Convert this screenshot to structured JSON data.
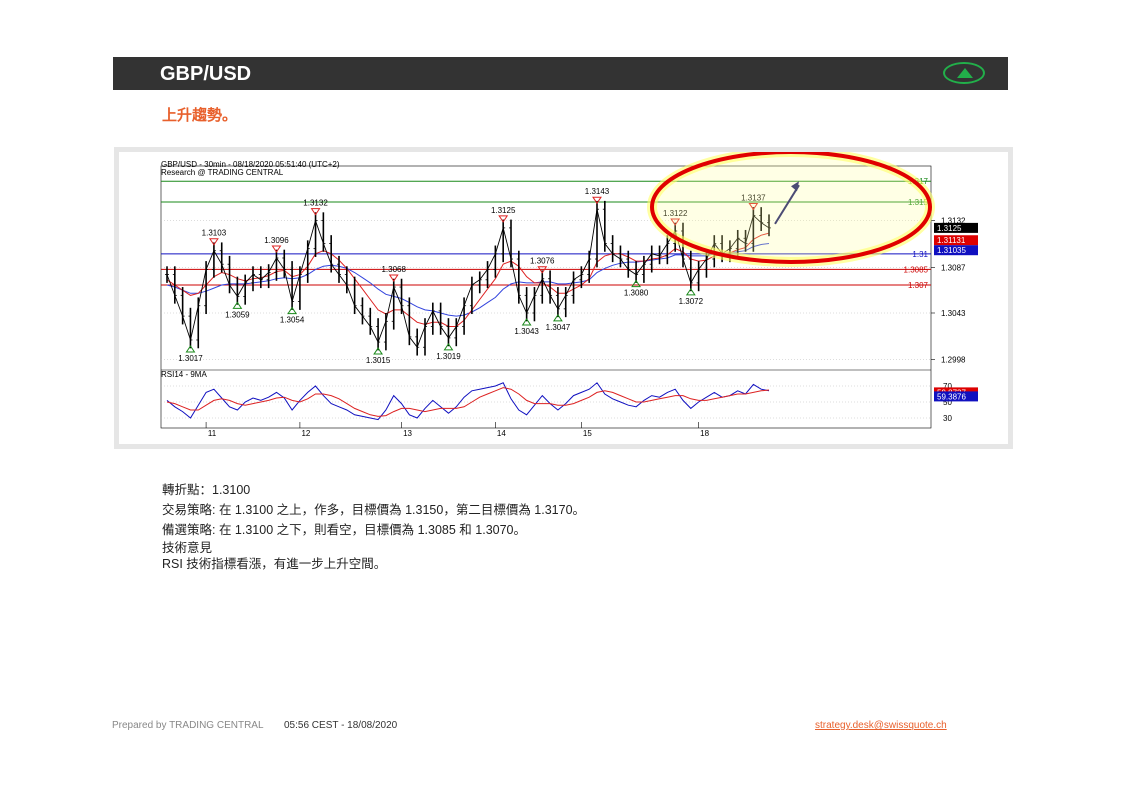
{
  "header": {
    "title": "GBP/USD",
    "trend_icon": "up-triangle-icon",
    "accent_color": "#22b04a"
  },
  "subtitle": "上升趨勢。",
  "chart_data": {
    "type": "line",
    "title": "GBP/USD - 30min - 08/18/2020 05:51:40 (UTC+2)",
    "source": "Research @ TRADING CENTRAL",
    "x_ticks": [
      "11",
      "12",
      "13",
      "14",
      "15",
      "18"
    ],
    "y_ticks": [
      "1.3132",
      "1.3087",
      "1.3043",
      "1.2998"
    ],
    "ylim": [
      1.299,
      1.3175
    ],
    "price_tags": {
      "last": "1.3125",
      "red": "1.31131",
      "blue": "1.31035"
    },
    "levels": [
      {
        "value": 1.317,
        "label": "1.317",
        "color": "#1a8a1a"
      },
      {
        "value": 1.315,
        "label": "1.315",
        "color": "#1a8a1a"
      },
      {
        "value": 1.31,
        "label": "1.31",
        "color": "#1010c0"
      },
      {
        "value": 1.3085,
        "label": "1.3085",
        "color": "#cc0000"
      },
      {
        "value": 1.307,
        "label": "1.307",
        "color": "#cc0000"
      }
    ],
    "price_series": [
      1.308,
      1.306,
      1.304,
      1.3017,
      1.305,
      1.3085,
      1.3103,
      1.309,
      1.307,
      1.3059,
      1.3072,
      1.308,
      1.3075,
      1.3082,
      1.3096,
      1.3085,
      1.3054,
      1.308,
      1.3105,
      1.3132,
      1.311,
      1.309,
      1.308,
      1.307,
      1.305,
      1.304,
      1.303,
      1.3015,
      1.3035,
      1.3068,
      1.305,
      1.302,
      1.301,
      1.303,
      1.3045,
      1.303,
      1.3019,
      1.303,
      1.305,
      1.307,
      1.3075,
      1.3085,
      1.31,
      1.3125,
      1.3095,
      1.306,
      1.3043,
      1.306,
      1.3076,
      1.306,
      1.3047,
      1.306,
      1.3075,
      1.308,
      1.3095,
      1.3143,
      1.311,
      1.31,
      1.3095,
      1.3085,
      1.308,
      1.309,
      1.31,
      1.3098,
      1.311,
      1.3122,
      1.3095,
      1.3072,
      1.3085,
      1.3095,
      1.311,
      1.31,
      1.3105,
      1.3115,
      1.311,
      1.3137,
      1.313,
      1.3125
    ],
    "ma_red": [
      1.3075,
      1.307,
      1.3065,
      1.306,
      1.3062,
      1.307,
      1.3078,
      1.3082,
      1.308,
      1.3076,
      1.3074,
      1.3076,
      1.3077,
      1.3079,
      1.3083,
      1.3084,
      1.3078,
      1.308,
      1.3088,
      1.31,
      1.3103,
      1.31,
      1.3094,
      1.3086,
      1.3076,
      1.3066,
      1.3056,
      1.3046,
      1.3042,
      1.3046,
      1.3046,
      1.304,
      1.3034,
      1.3032,
      1.3034,
      1.3034,
      1.303,
      1.303,
      1.3036,
      1.3046,
      1.3056,
      1.3066,
      1.3076,
      1.309,
      1.3093,
      1.3088,
      1.3078,
      1.3072,
      1.3072,
      1.3068,
      1.3062,
      1.3062,
      1.3066,
      1.307,
      1.3076,
      1.3092,
      1.3098,
      1.31,
      1.31,
      1.3097,
      1.3093,
      1.3093,
      1.3095,
      1.3096,
      1.3099,
      1.3105,
      1.3102,
      1.3095,
      1.3093,
      1.3094,
      1.3098,
      1.3099,
      1.3101,
      1.3104,
      1.3106,
      1.3114,
      1.3118,
      1.312
    ],
    "ma_blue": [
      1.307,
      1.3068,
      1.3065,
      1.3062,
      1.3062,
      1.3064,
      1.3067,
      1.307,
      1.3071,
      1.3071,
      1.3071,
      1.3072,
      1.3073,
      1.3074,
      1.3076,
      1.3077,
      1.3076,
      1.3077,
      1.308,
      1.3085,
      1.3088,
      1.3089,
      1.3088,
      1.3086,
      1.3082,
      1.3077,
      1.3072,
      1.3066,
      1.3061,
      1.3059,
      1.3057,
      1.3053,
      1.3049,
      1.3046,
      1.3045,
      1.3043,
      1.3041,
      1.304,
      1.3041,
      1.3044,
      1.3048,
      1.3053,
      1.3058,
      1.3066,
      1.3071,
      1.3073,
      1.3072,
      1.3072,
      1.3073,
      1.3073,
      1.3071,
      1.3071,
      1.3072,
      1.3073,
      1.3075,
      1.3082,
      1.3086,
      1.3089,
      1.3091,
      1.3092,
      1.3092,
      1.3093,
      1.3094,
      1.3095,
      1.3096,
      1.3099,
      1.3099,
      1.3098,
      1.3098,
      1.3098,
      1.31,
      1.31,
      1.3101,
      1.3102,
      1.3103,
      1.3107,
      1.3109,
      1.311
    ],
    "annotations": [
      {
        "label": "1.3017",
        "i": 3,
        "dir": "low"
      },
      {
        "label": "1.3103",
        "i": 6,
        "dir": "high"
      },
      {
        "label": "1.3059",
        "i": 9,
        "dir": "low"
      },
      {
        "label": "1.3096",
        "i": 14,
        "dir": "high"
      },
      {
        "label": "1.3054",
        "i": 16,
        "dir": "low"
      },
      {
        "label": "1.3132",
        "i": 19,
        "dir": "high"
      },
      {
        "label": "1.3015",
        "i": 27,
        "dir": "low"
      },
      {
        "label": "1.3068",
        "i": 29,
        "dir": "high"
      },
      {
        "label": "1.3019",
        "i": 36,
        "dir": "low"
      },
      {
        "label": "1.3125",
        "i": 43,
        "dir": "high"
      },
      {
        "label": "1.3043",
        "i": 46,
        "dir": "low"
      },
      {
        "label": "1.3076",
        "i": 48,
        "dir": "high"
      },
      {
        "label": "1.3047",
        "i": 50,
        "dir": "low"
      },
      {
        "label": "1.3143",
        "i": 55,
        "dir": "high"
      },
      {
        "label": "1.3080",
        "i": 60,
        "dir": "low"
      },
      {
        "label": "1.3122",
        "i": 65,
        "dir": "high"
      },
      {
        "label": "1.3072",
        "i": 67,
        "dir": "low"
      },
      {
        "label": "1.3137",
        "i": 75,
        "dir": "high"
      }
    ],
    "rsi": {
      "label": "RSI14 - 9MA",
      "y_ticks": [
        "70",
        "50",
        "30"
      ],
      "tags": [
        "59.8737",
        "59.3876"
      ],
      "values": [
        52,
        44,
        38,
        30,
        46,
        62,
        66,
        55,
        44,
        40,
        50,
        55,
        52,
        56,
        62,
        55,
        40,
        52,
        62,
        70,
        58,
        48,
        44,
        40,
        34,
        32,
        30,
        28,
        40,
        58,
        48,
        34,
        30,
        42,
        52,
        44,
        36,
        44,
        56,
        64,
        66,
        68,
        70,
        74,
        54,
        40,
        34,
        46,
        58,
        48,
        40,
        48,
        58,
        62,
        66,
        74,
        60,
        54,
        50,
        46,
        44,
        52,
        58,
        56,
        62,
        66,
        52,
        42,
        50,
        56,
        62,
        56,
        58,
        64,
        60,
        72,
        66,
        64
      ],
      "ma": [
        50,
        48,
        44,
        40,
        40,
        46,
        52,
        54,
        52,
        48,
        46,
        48,
        50,
        52,
        55,
        56,
        52,
        50,
        54,
        60,
        60,
        58,
        54,
        48,
        42,
        38,
        34,
        32,
        33,
        38,
        42,
        42,
        40,
        38,
        40,
        42,
        42,
        42,
        44,
        50,
        56,
        60,
        64,
        68,
        66,
        60,
        52,
        48,
        48,
        48,
        46,
        46,
        48,
        52,
        56,
        62,
        64,
        62,
        58,
        54,
        50,
        50,
        52,
        54,
        56,
        58,
        58,
        54,
        52,
        52,
        54,
        56,
        58,
        60,
        60,
        62,
        64,
        65
      ]
    }
  },
  "notes": {
    "pivot": "轉折點：1.3100",
    "strategy": "交易策略: 在 1.3100 之上，作多，目標價為  1.3150，第二目標價為  1.3170。",
    "alternative": "備選策略: 在 1.3100 之下，則看空，目標價為  1.3085 和 1.3070。",
    "opinion_title": "技術意見",
    "opinion": "RSI 技術指標看漲，有進一步上升空間。"
  },
  "footer": {
    "prepared_by": "Prepared by TRADING CENTRAL",
    "timestamp": "05:56 CEST - 18/08/2020",
    "email": "strategy.desk@swissquote.ch"
  }
}
